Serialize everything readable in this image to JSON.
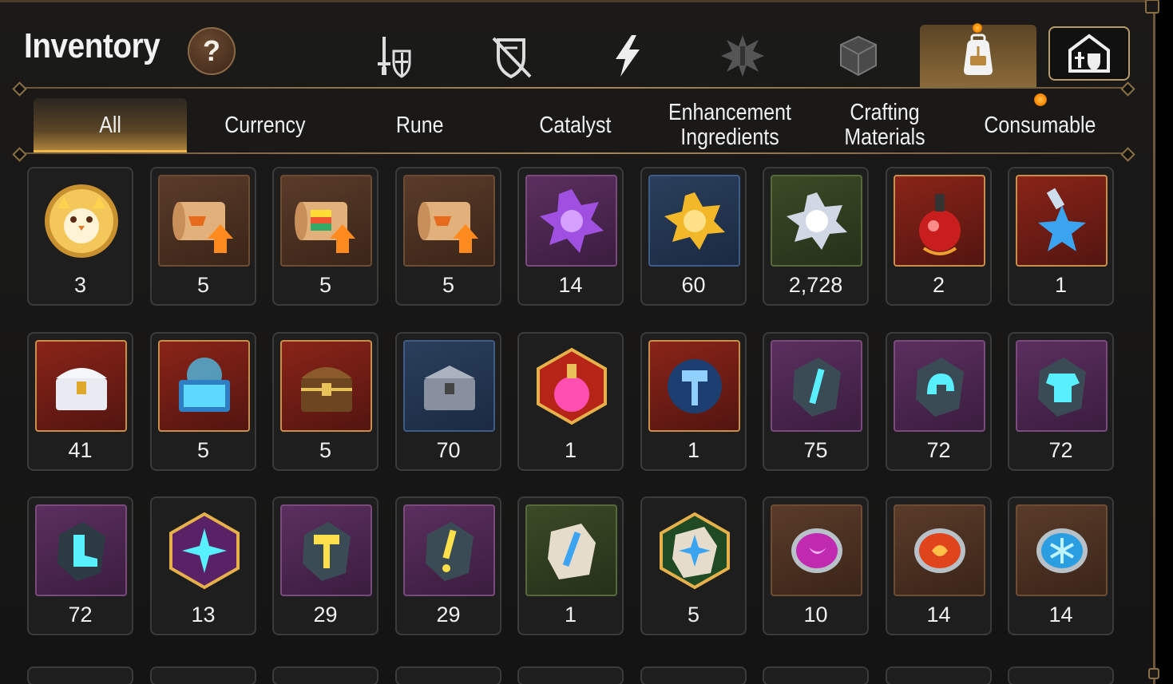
{
  "header": {
    "title": "Inventory",
    "help_label": "?"
  },
  "category_tabs": [
    {
      "name": "sword-shield-icon"
    },
    {
      "name": "crossed-shield-icon"
    },
    {
      "name": "lightning-icon"
    },
    {
      "name": "spiky-emblem-icon"
    },
    {
      "name": "cube-icon"
    },
    {
      "name": "backpack-icon",
      "active": true
    },
    {
      "name": "castle-armory-icon"
    }
  ],
  "sub_tabs": [
    "All",
    "Currency",
    "Rune",
    "Catalyst",
    "Enhancement Ingredients",
    "Crafting Materials",
    "Consumable"
  ],
  "active_sub_tab": "All",
  "items": [
    {
      "icon": "chick-portrait-icon",
      "qty": "3"
    },
    {
      "icon": "scroll-upgrade-icon",
      "qty": "5"
    },
    {
      "icon": "rainbow-scroll-icon",
      "qty": "5"
    },
    {
      "icon": "scroll-upgrade-icon",
      "qty": "5"
    },
    {
      "icon": "purple-crystal-icon",
      "qty": "14"
    },
    {
      "icon": "gold-crystal-icon",
      "qty": "60"
    },
    {
      "icon": "silver-crystal-icon",
      "qty": "2,728"
    },
    {
      "icon": "red-potion-icon",
      "qty": "2"
    },
    {
      "icon": "star-potion-icon",
      "qty": "1"
    },
    {
      "icon": "silver-chest-icon",
      "qty": "41"
    },
    {
      "icon": "blue-chest-icon",
      "qty": "5"
    },
    {
      "icon": "wooden-chest-icon",
      "qty": "5"
    },
    {
      "icon": "iron-chest-icon",
      "qty": "70"
    },
    {
      "icon": "pink-potion-icon",
      "qty": "1"
    },
    {
      "icon": "hammer-rune-icon",
      "qty": "1"
    },
    {
      "icon": "sword-stone-icon",
      "qty": "75"
    },
    {
      "icon": "helmet-stone-icon",
      "qty": "72"
    },
    {
      "icon": "armor-stone-icon",
      "qty": "72"
    },
    {
      "icon": "boot-stone-icon",
      "qty": "72"
    },
    {
      "icon": "star-stone-icon",
      "qty": "13"
    },
    {
      "icon": "hammer-stone-icon",
      "qty": "29"
    },
    {
      "icon": "exclaim-stone-icon",
      "qty": "29"
    },
    {
      "icon": "blade-tablet-icon",
      "qty": "1"
    },
    {
      "icon": "star-tablet-icon",
      "qty": "5"
    },
    {
      "icon": "moon-orb-icon",
      "qty": "10"
    },
    {
      "icon": "fire-orb-icon",
      "qty": "14"
    },
    {
      "icon": "frost-orb-icon",
      "qty": "14"
    }
  ],
  "colors": {
    "accent_gold": "#f0b84a",
    "frame_bronze": "#8a6e44"
  }
}
